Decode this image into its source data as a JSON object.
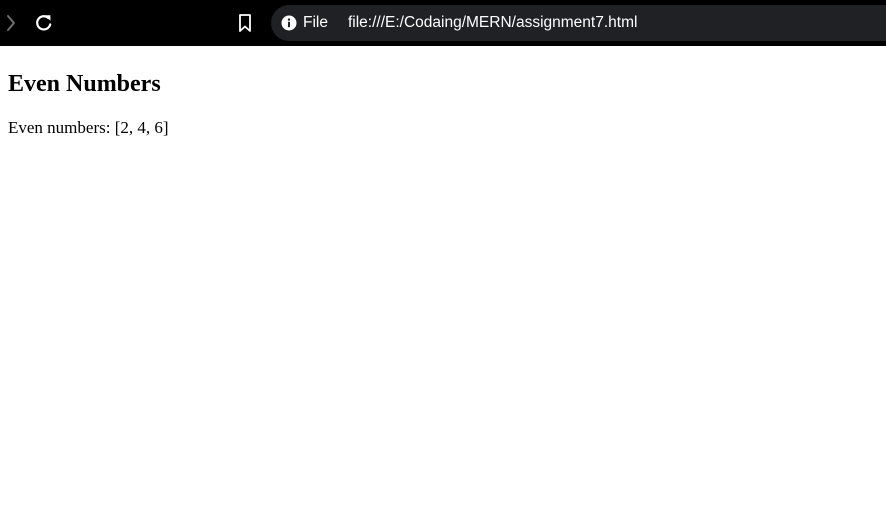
{
  "browser": {
    "icons": {
      "forward": "chevron-right-icon",
      "reload": "reload-icon",
      "bookmark": "bookmark-icon",
      "site_info": "info-icon"
    },
    "omnibox": {
      "scheme_chip": "File",
      "url": "file:///E:/Codaing/MERN/assignment7.html"
    },
    "colors": {
      "toolbar_bg": "#000000",
      "omnibox_bg": "#202124",
      "icon": "#ffffff"
    }
  },
  "page": {
    "heading": "Even Numbers",
    "result": "Even numbers: [2, 4, 6]"
  }
}
